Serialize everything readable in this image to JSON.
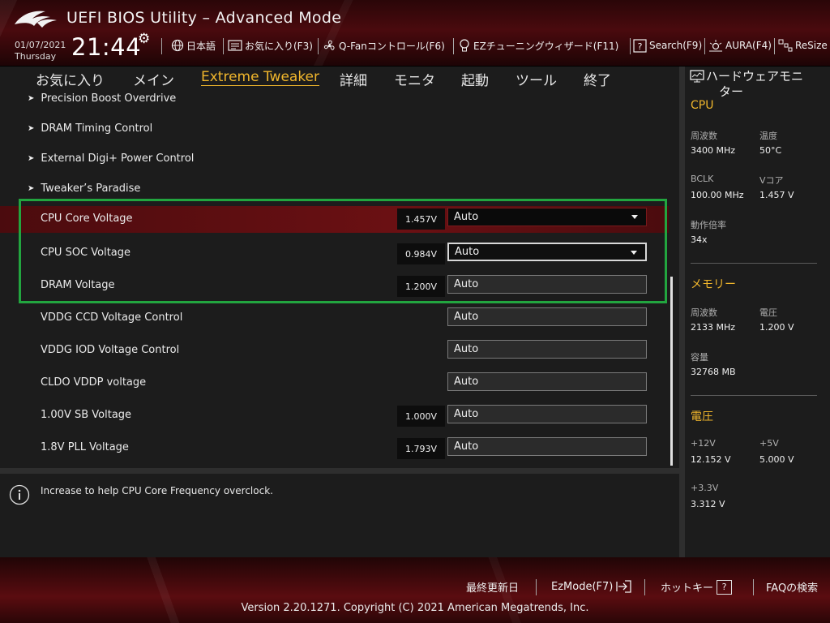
{
  "header": {
    "title": "UEFI BIOS Utility – Advanced Mode",
    "date": "01/07/2021",
    "weekday": "Thursday",
    "time": "21:44",
    "toolbar": [
      {
        "label": "日本語",
        "icon": "globe-icon"
      },
      {
        "label": "お気に入り(F3)",
        "icon": "favorites-icon"
      },
      {
        "label": "Q-Fanコントロール(F6)",
        "icon": "fan-icon"
      },
      {
        "label": "EZチューニングウィザード(F11)",
        "icon": "lightbulb-icon"
      },
      {
        "label": "Search(F9)",
        "icon": "help-box-icon"
      },
      {
        "label": "AURA(F4)",
        "icon": "aura-icon"
      },
      {
        "label": "ReSize",
        "icon": "resize-icon"
      }
    ]
  },
  "tabs": [
    {
      "label": "お気に入り"
    },
    {
      "label": "メイン"
    },
    {
      "label": "Extreme Tweaker",
      "active": true
    },
    {
      "label": "詳細"
    },
    {
      "label": "モニタ"
    },
    {
      "label": "起動"
    },
    {
      "label": "ツール"
    },
    {
      "label": "終了"
    }
  ],
  "submenus": [
    {
      "label": "Precision Boost Overdrive"
    },
    {
      "label": "DRAM Timing Control"
    },
    {
      "label": "External Digi+ Power Control"
    },
    {
      "label": "Tweaker’s Paradise"
    }
  ],
  "settings": [
    {
      "label": "CPU Core Voltage",
      "current": "1.457V",
      "value": "Auto",
      "dropdown": true,
      "selected": true
    },
    {
      "label": "CPU SOC Voltage",
      "current": "0.984V",
      "value": "Auto",
      "dropdown": true
    },
    {
      "label": "DRAM Voltage",
      "current": "1.200V",
      "value": "Auto"
    },
    {
      "label": "VDDG CCD Voltage Control",
      "current": "",
      "value": "Auto"
    },
    {
      "label": "VDDG IOD Voltage Control",
      "current": "",
      "value": "Auto"
    },
    {
      "label": "CLDO VDDP voltage",
      "current": "",
      "value": "Auto"
    },
    {
      "label": "1.00V SB Voltage",
      "current": "1.000V",
      "value": "Auto"
    },
    {
      "label": "1.8V PLL Voltage",
      "current": "1.793V",
      "value": "Auto"
    }
  ],
  "help": {
    "text": "Increase to help CPU Core Frequency overclock."
  },
  "monitor": {
    "title_line1": "ハードウェアモニ",
    "title_line2": "ター",
    "cpu": {
      "heading": "CPU",
      "freq_label": "周波数",
      "freq": "3400 MHz",
      "temp_label": "温度",
      "temp": "50°C",
      "bclk_label": "BCLK",
      "bclk": "100.00 MHz",
      "vcore_label": "Vコア",
      "vcore": "1.457 V",
      "ratio_label": "動作倍率",
      "ratio": "34x"
    },
    "memory": {
      "heading": "メモリー",
      "freq_label": "周波数",
      "freq": "2133 MHz",
      "volt_label": "電圧",
      "volt": "1.200 V",
      "cap_label": "容量",
      "cap": "32768 MB"
    },
    "voltage": {
      "heading": "電圧",
      "v12_label": "+12V",
      "v12": "12.152 V",
      "v5_label": "+5V",
      "v5": "5.000 V",
      "v33_label": "+3.3V",
      "v33": "3.312 V"
    }
  },
  "footer": {
    "last_modified": "最終更新日",
    "ezmode": "EzMode(F7)",
    "hotkeys": "ホットキー",
    "hotkeys_key": "?",
    "faq": "FAQの検索",
    "copyright": "Version 2.20.1271. Copyright (C) 2021 American Megatrends, Inc."
  },
  "colors": {
    "accent": "#f0b62c",
    "highlight_border": "#22a53f",
    "selected_row": "#6b1013"
  }
}
